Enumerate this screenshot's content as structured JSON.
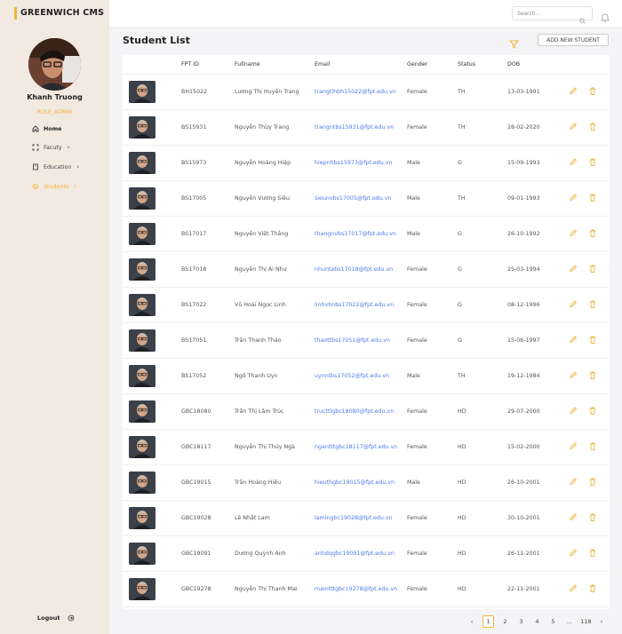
{
  "brand": "GREENWICH CMS",
  "user": {
    "name": "Khanh Truong",
    "role": "ROLE_ADMIN"
  },
  "nav": {
    "home": "Home",
    "faculty": "Facuty",
    "education": "Education",
    "students": "Students",
    "logout": "Logout"
  },
  "search": {
    "placeholder": "Search..."
  },
  "page": {
    "title": "Student List",
    "add_label": "ADD NEW STUDENT"
  },
  "table": {
    "columns": [
      "FPT ID",
      "Fullname",
      "Email",
      "Gender",
      "Status",
      "DOB"
    ],
    "rows": [
      [
        "BH15022",
        "Lương Thị Huyền Trang",
        "trangtlhbh15022@fpt.edu.vn",
        "Female",
        "TH",
        "13-03-1991"
      ],
      [
        "BS15931",
        "Nguyễn Thùy Trang",
        "trangntbs15931@fpt.edu.vn",
        "Female",
        "TH",
        "28-02-2020"
      ],
      [
        "BS15973",
        "Nguyễn Hoàng Hiệp",
        "hiepnhbs15973@fpt.edu.vn",
        "Male",
        "G",
        "15-09-1993"
      ],
      [
        "BS17005",
        "Nguyễn Vương Siêu",
        "sieunvbs17005@fpt.edu.vn",
        "Male",
        "TH",
        "09-01-1993"
      ],
      [
        "BS17017",
        "Nguyễn Việt Thắng",
        "thangnvbs17017@fpt.edu.vn",
        "Male",
        "G",
        "26-10-1992"
      ],
      [
        "BS17018",
        "Nguyễn Thị Ái Như",
        "nhuntabs17018@fpt.edu.vn",
        "Female",
        "G",
        "25-03-1994"
      ],
      [
        "BS17022",
        "Vũ Hoài Ngọc Linh",
        "linhvhnbs17022@fpt.edu.vn",
        "Female",
        "G",
        "08-12-1996"
      ],
      [
        "BS17051",
        "Trần Thanh Thảo",
        "thaottbs17051@fpt.edu.vn",
        "Female",
        "G",
        "15-06-1997"
      ],
      [
        "BS17052",
        "Ngô Thanh Uyn",
        "uynntbs17052@fpt.edu.vn",
        "Male",
        "TH",
        "19-12-1984"
      ],
      [
        "GBC18080",
        "Trần Thị Lâm Trúc",
        "tructtlgbc18080@fpt.edu.vn",
        "Female",
        "HD",
        "29-07-2000"
      ],
      [
        "GBC18117",
        "Nguyễn Thị Thúy Ngà",
        "ngantttgbc18117@fpt.edu.vn",
        "Female",
        "HD",
        "15-02-2000"
      ],
      [
        "GBC19015",
        "Trần Hoàng Hiếu",
        "hieuthgbc19015@fpt.edu.vn",
        "Male",
        "HD",
        "26-10-2001"
      ],
      [
        "GBC19028",
        "Lê Nhật Lam",
        "lamlngbc19028@fpt.edu.vn",
        "Female",
        "HD",
        "30-10-2001"
      ],
      [
        "GBC19091",
        "Dương Quỳnh Anh",
        "anhdqgbc19091@fpt.edu.vn",
        "Female",
        "HD",
        "26-11-2001"
      ],
      [
        "GBC19278",
        "Nguyễn Thị Thanh Mai",
        "maintttgbc19278@fpt.edu.vn",
        "Female",
        "HD",
        "22-11-2001"
      ]
    ]
  },
  "pagination": {
    "prev": "‹",
    "pages": [
      "1",
      "2",
      "3",
      "4",
      "5"
    ],
    "ellipsis": "...",
    "last": "118",
    "next": "›",
    "current": "1"
  },
  "colors": {
    "accent": "#f0b43c",
    "link": "#4a7ee8",
    "sidebar": "#f2e9e1"
  },
  "icons": {
    "home": "home-icon",
    "faculty": "scan-icon",
    "education": "book-icon",
    "students": "gear-icon",
    "logout": "logout-icon",
    "search": "search-icon",
    "bell": "bell-icon",
    "filter": "filter-icon",
    "edit": "pencil-icon",
    "delete": "trash-icon"
  }
}
